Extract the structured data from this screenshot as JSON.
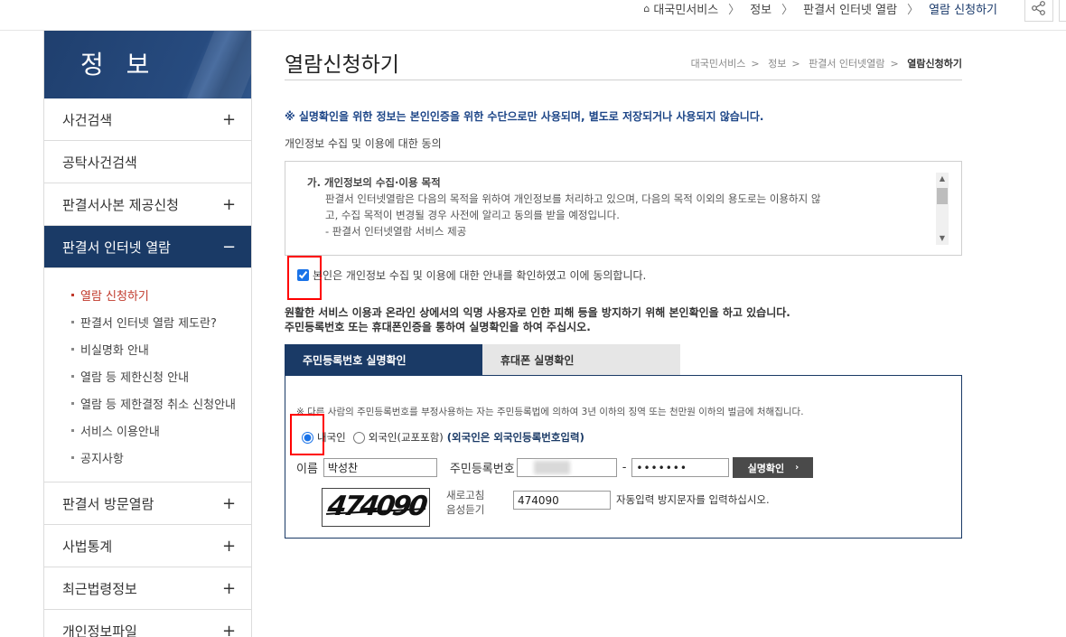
{
  "top_breadcrumb": [
    "대국민서비스",
    "정보",
    "판결서 인터넷 열람",
    "열람 신청하기"
  ],
  "icons": {
    "home": "home-icon",
    "share": "share-icon"
  },
  "sidebar": {
    "title": "정 보",
    "items_top": [
      {
        "label": "사건검색",
        "toggle": "+"
      },
      {
        "label": "공탁사건검색",
        "toggle": ""
      },
      {
        "label": "판결서사본 제공신청",
        "toggle": "+"
      },
      {
        "label": "판결서 인터넷 열람",
        "toggle": "−"
      }
    ],
    "submenu": [
      "열람 신청하기",
      "판결서 인터넷 열람 제도란?",
      "비실명화 안내",
      "열람 등 제한신청 안내",
      "열람 등 제한결정 취소 신청안내",
      "서비스 이용안내",
      "공지사항"
    ],
    "items_bottom": [
      {
        "label": "판결서 방문열람",
        "toggle": "+"
      },
      {
        "label": "사법통계",
        "toggle": "+"
      },
      {
        "label": "최근법령정보",
        "toggle": "+"
      },
      {
        "label": "개인정보파일",
        "toggle": "+"
      }
    ]
  },
  "main": {
    "title": "열람신청하기",
    "breadcrumb": [
      "대국민서비스",
      "정보",
      "판결서 인터넷열람",
      "열람신청하기"
    ],
    "notice": "※ 실명확인을 위한 정보는 본인인증을 위한 수단으로만 사용되며, 별도로 저장되거나 사용되지 않습니다.",
    "agree_title": "개인정보 수집 및 이용에 대한 동의",
    "agree_heading": "가. 개인정보의 수집·이용 목적",
    "agree_line1": "판결서 인터넷열람은 다음의 목적을 위하여 개인정보를 처리하고 있으며, 다음의 목적 이외의 용도로는 이용하지 않",
    "agree_line2": "고, 수집 목적이 변경될 경우 사전에 알리고 동의를 받을 예정입니다.",
    "agree_line3": "- 판결서 인터넷열람 서비스 제공",
    "agree_check_label": "본인은 개인정보 수집 및 이용에 대한 안내를 확인하였고 이에 동의합니다.",
    "desc_line1": "원활한 서비스 이용과 온라인 상에서의 익명 사용자로 인한 피해 등을 방지하기 위해 본인확인을 하고 있습니다.",
    "desc_line2": "주민등록번호 또는 휴대폰인증을 통하여 실명확인을 하여 주십시오.",
    "tabs": [
      "주민등록번호 실명확인",
      "휴대폰 실명확인"
    ],
    "warning": "※ 다른 사람의 주민등록번호를 부정사용하는 자는 주민등록법에 의하여 3년 이하의 징역 또는 천만원 이하의 벌금에 처해집니다.",
    "radio_domestic": "내국인",
    "radio_foreign": "외국인(교포포함)",
    "radio_foreign_note": "(외국인은 외국인등록번호입력)",
    "name_label": "이름",
    "name_value": "박성찬",
    "rrn_label": "주민등록번호",
    "rrn_dash": "-",
    "rrn_back_masked": "•••••••",
    "verify_button": "실명확인",
    "captcha_text": "474090",
    "refresh_link": "새로고침",
    "audio_link": "음성듣기",
    "captcha_input": "474090",
    "captcha_help": "자동입력 방지문자를 입력하십시오."
  }
}
